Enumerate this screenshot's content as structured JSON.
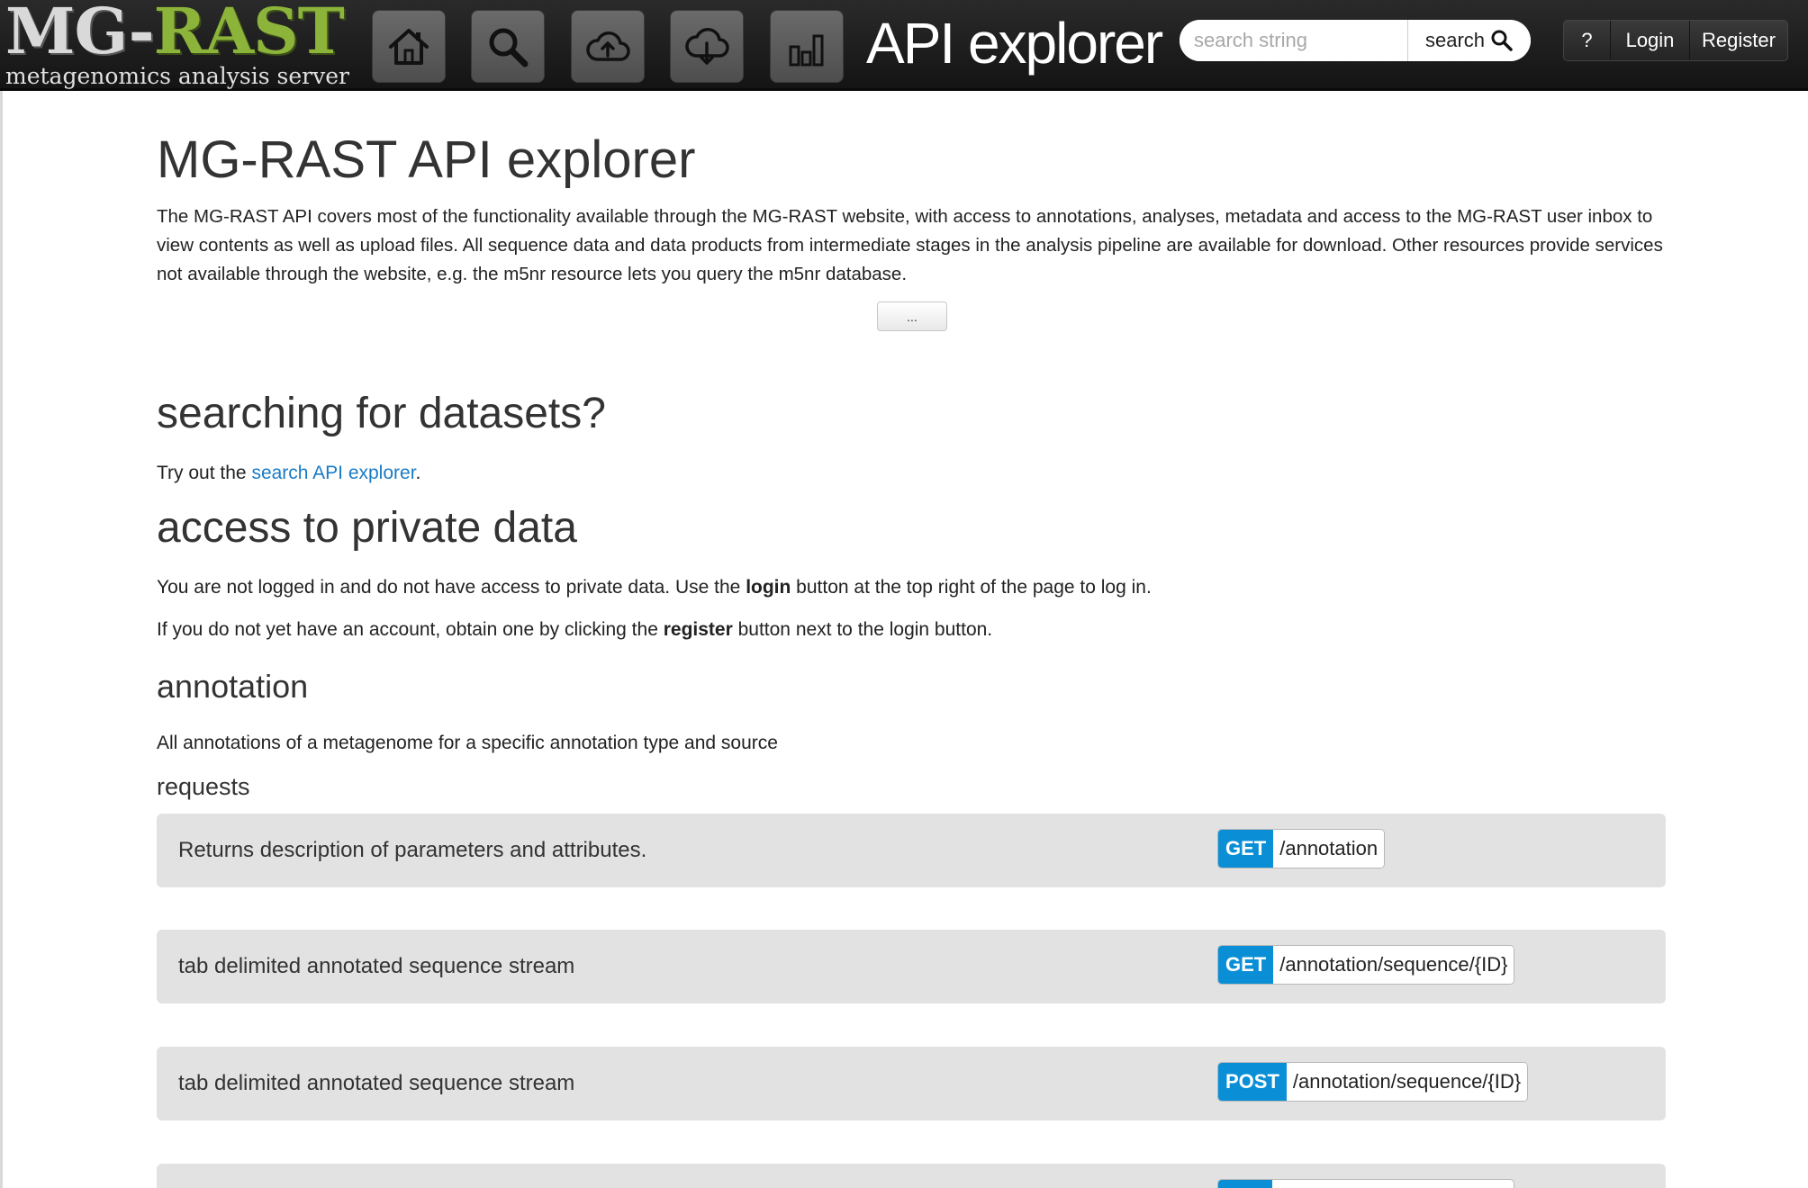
{
  "header": {
    "logo": {
      "title_part1": "MG-",
      "title_part2": "RAST",
      "subtitle": "metagenomics analysis server"
    },
    "nav_buttons": [
      {
        "icon": "home-icon"
      },
      {
        "icon": "search-icon"
      },
      {
        "icon": "cloud-upload-icon"
      },
      {
        "icon": "cloud-download-icon"
      },
      {
        "icon": "bar-chart-icon"
      }
    ],
    "app_title": "API explorer",
    "search": {
      "placeholder": "search string",
      "value": "",
      "button_label": "search"
    },
    "help_label": "?",
    "login_label": "Login",
    "register_label": "Register"
  },
  "main": {
    "title": "MG-RAST API explorer",
    "intro": "The MG-RAST API covers most of the functionality available through the MG-RAST website, with access to annotations, analyses, metadata and access to the MG-RAST user inbox to view contents as well as upload files. All sequence data and data products from intermediate stages in the analysis pipeline are available for download. Other resources provide services not available through the website, e.g. the m5nr resource lets you query the m5nr database.",
    "more_button_label": "...",
    "searching": {
      "heading": "searching for datasets?",
      "text_before": "Try out the ",
      "link_label": "search API explorer",
      "text_after": "."
    },
    "private": {
      "heading": "access to private data",
      "line1_before": "You are not logged in and do not have access to private data. Use the ",
      "line1_bold": "login",
      "line1_after": " button at the top right of the page to log in.",
      "line2_before": "If you do not yet have an account, obtain one by clicking the ",
      "line2_bold": "register",
      "line2_after": " button next to the login button."
    },
    "annotation": {
      "heading": "annotation",
      "description": "All annotations of a metagenome for a specific annotation type and source",
      "requests_label": "requests",
      "requests": [
        {
          "description": "Returns description of parameters and attributes.",
          "method": "GET",
          "path": "/annotation"
        },
        {
          "description": "tab delimited annotated sequence stream",
          "method": "GET",
          "path": "/annotation/sequence/{ID}"
        },
        {
          "description": "tab delimited annotated sequence stream",
          "method": "POST",
          "path": "/annotation/sequence/{ID}"
        }
      ]
    }
  },
  "colors": {
    "navbar": "#1a1a1a",
    "logo_green": "#8cb43a",
    "method_blue": "#0a8fd6",
    "link_blue": "#1a7bc4",
    "request_bg": "#e2e2e2"
  }
}
